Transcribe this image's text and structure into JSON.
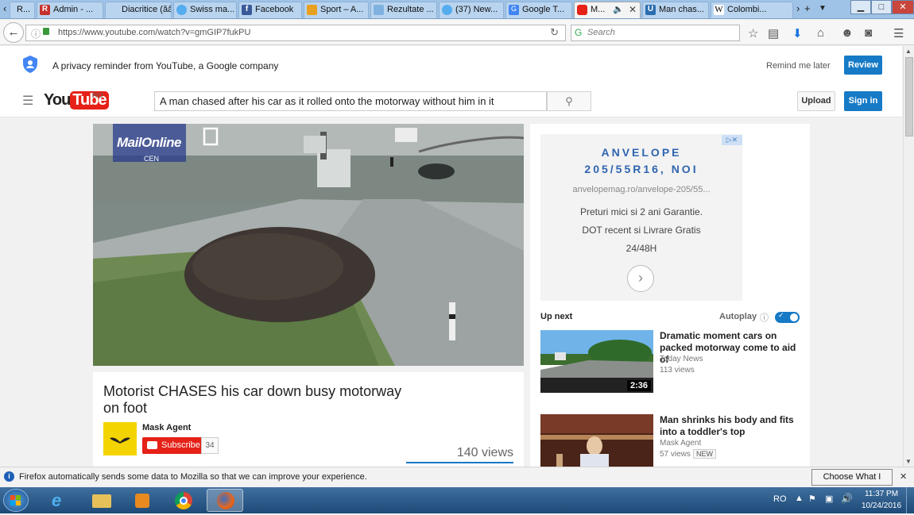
{
  "browser": {
    "tabs": [
      {
        "label": "R...",
        "icon": "tab-scroll-left"
      },
      {
        "label": "Admin - ...",
        "icon": "r-favicon"
      },
      {
        "label": "Diacritice (ăâî...",
        "icon": "blank-favicon"
      },
      {
        "label": "Swiss ma...",
        "icon": "twitter-favicon"
      },
      {
        "label": "Facebook",
        "icon": "facebook-favicon"
      },
      {
        "label": "Sport – A...",
        "icon": "sport-favicon"
      },
      {
        "label": "Rezultate ...",
        "icon": "blank-favicon"
      },
      {
        "label": "(37) New...",
        "icon": "twitter-favicon"
      },
      {
        "label": "Google T...",
        "icon": "google-translate-favicon"
      },
      {
        "label": "M...",
        "icon": "youtube-favicon"
      },
      {
        "label": "Man chas...",
        "icon": "u-favicon"
      },
      {
        "label": "Colombi...",
        "icon": "wikipedia-favicon"
      }
    ],
    "url": "https://www.youtube.com/watch?v=gmGIP7fukPU",
    "search_placeholder": "Search"
  },
  "privacy": {
    "text": "A privacy reminder from YouTube, a Google company",
    "remind_label": "Remind me later",
    "review_label": "Review"
  },
  "youtube": {
    "logo_you": "You",
    "logo_tube": "Tube",
    "region": "RO",
    "search_value": "A man chased after his car as it rolled onto the motorway without him in it",
    "upload_label": "Upload",
    "signin_label": "Sign in"
  },
  "video": {
    "overlay_brand": "MailOnline",
    "overlay_credit": "CEN",
    "title": "Motorist CHASES his car down busy motorway on foot",
    "channel": "Mask Agent",
    "subscribe_label": "Subscribe",
    "subscriber_count": "34",
    "views": "140 views"
  },
  "ad": {
    "headline_line1": "ANVELOPE",
    "headline_line2": "205/55R16, NOI",
    "url": "anvelopemag.ro/anvelope-205/55...",
    "line1": "Preturi mici si 2 ani Garantie.",
    "line2": "DOT recent si Livrare Gratis",
    "line3": "24/48H"
  },
  "sidebar": {
    "up_next_label": "Up next",
    "autoplay_label": "Autoplay",
    "videos": [
      {
        "title": "Dramatic moment cars on packed motorway come to aid of",
        "channel": "Today News",
        "views": "113 views",
        "duration": "2:36",
        "badge": ""
      },
      {
        "title": "Man shrinks his body and fits into a toddler's top",
        "channel": "Mask Agent",
        "views": "57 views",
        "duration": "",
        "badge": "NEW"
      }
    ]
  },
  "notification": {
    "text": "Firefox automatically sends some data to Mozilla so that we can improve your experience.",
    "button_label": "Choose What I Share"
  },
  "taskbar": {
    "language": "RO",
    "time": "11:37 PM",
    "date": "10/24/2016"
  }
}
